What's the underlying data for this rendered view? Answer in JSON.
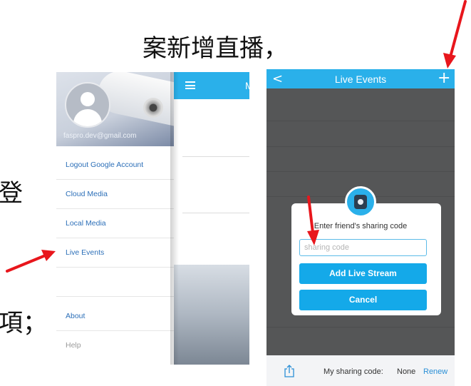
{
  "slide": {
    "text_top": "案新增直播，",
    "text_mid": "登",
    "text_bottom": "項；"
  },
  "left_phone": {
    "email": "faspro.dev@gmail.com",
    "menu": [
      {
        "label": "Logout Google Account"
      },
      {
        "label": "Cloud Media"
      },
      {
        "label": "Local Media"
      },
      {
        "label": "Live Events"
      },
      {
        "label": ""
      },
      {
        "label": "About"
      },
      {
        "label": "Help"
      }
    ],
    "main_title_initial": "M"
  },
  "right_phone": {
    "back": "<",
    "title": "Live Events",
    "add": "+",
    "dialog": {
      "message": "Enter friend's sharing code",
      "input_placeholder": "sharing code",
      "input_value": "",
      "add_button": "Add Live Stream",
      "cancel_button": "Cancel"
    },
    "bottom": {
      "share_label": "My sharing code:",
      "share_value": "None",
      "renew": "Renew"
    }
  },
  "colors": {
    "accent_blue": "#2ab0ea",
    "button_blue": "#14a9e9",
    "arrow_red": "#e8161c",
    "dark_bg": "#555657"
  }
}
